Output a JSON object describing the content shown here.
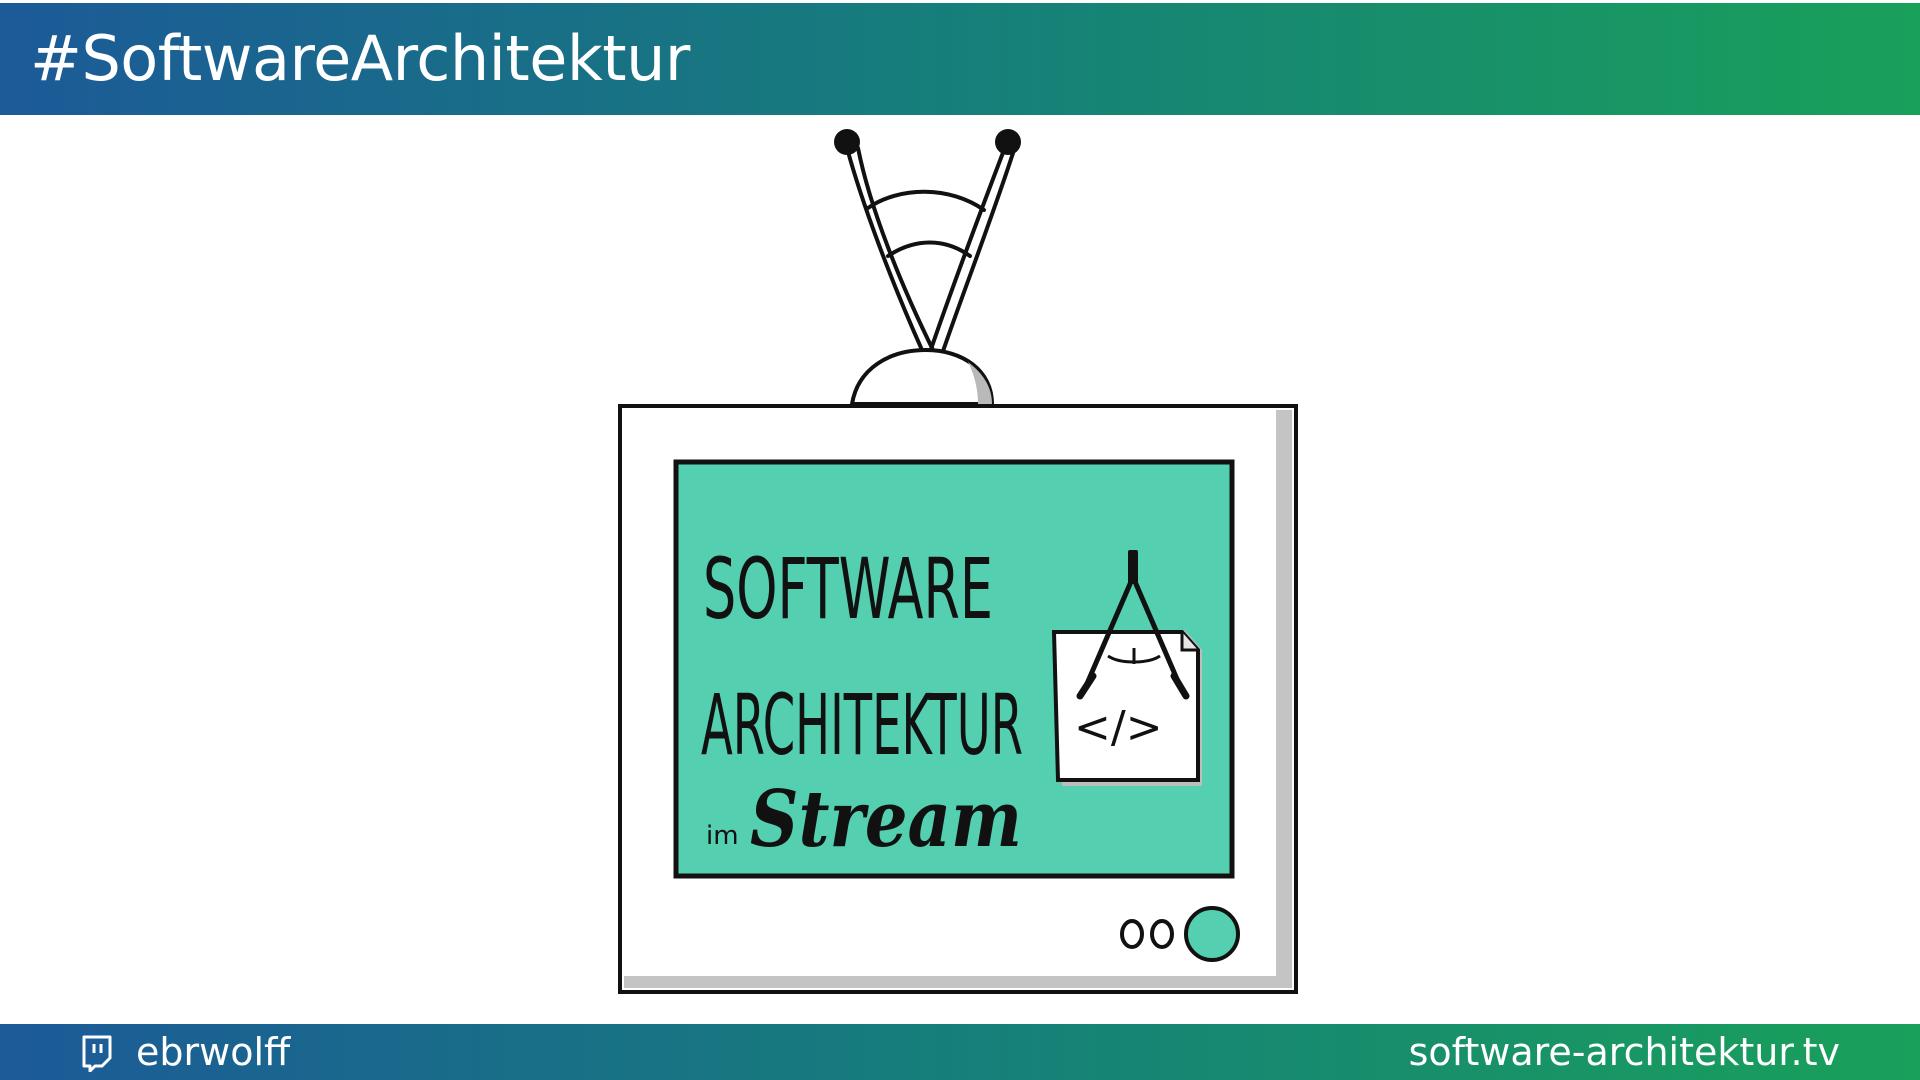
{
  "header": {
    "hashtag": "#SoftwareArchitektur"
  },
  "footer": {
    "channel_icon": "twitch-icon",
    "channel_name": "ebrwolff",
    "website": "software-architektur.tv"
  },
  "illustration": {
    "line1": "SOFTWARE",
    "line2": "ARCHITEKTUR",
    "prefix": "im",
    "stream_word": "Stream",
    "code_symbol": "</>",
    "screen_color": "#54cfb0",
    "button_color": "#54cfb0"
  },
  "colors": {
    "bar_start": "#1c5a98",
    "bar_mid": "#167f7a",
    "bar_end": "#19a05a"
  }
}
